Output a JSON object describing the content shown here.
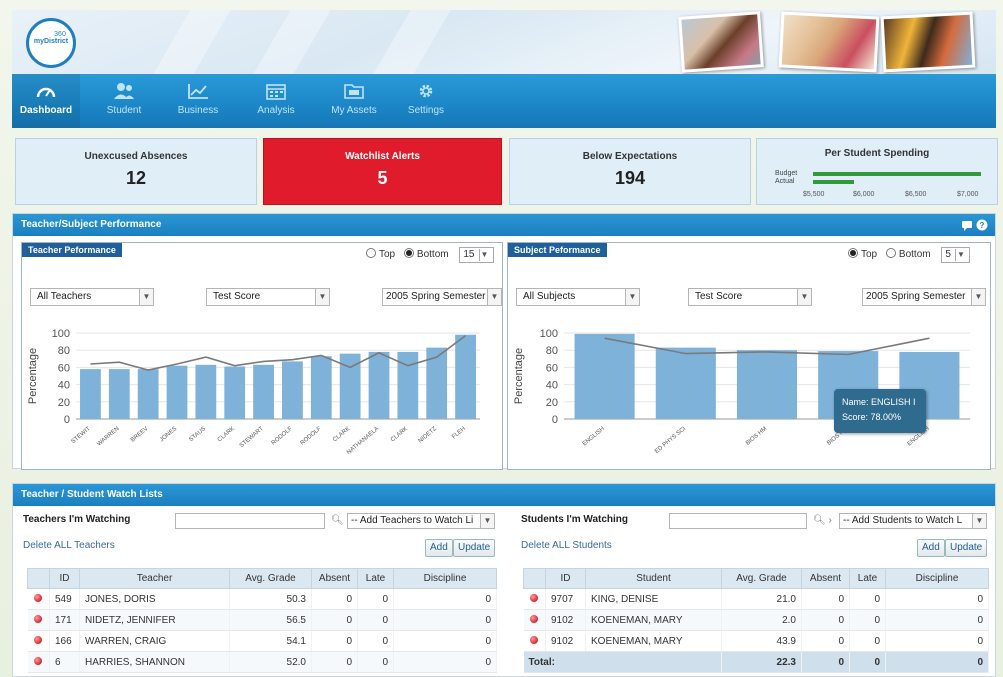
{
  "logo": {
    "line1": "360",
    "line2": "myDistrict"
  },
  "nav": [
    {
      "label": "Dashboard",
      "icon": "gauge-icon",
      "active": true
    },
    {
      "label": "Student",
      "icon": "users-icon"
    },
    {
      "label": "Business",
      "icon": "line-chart-icon"
    },
    {
      "label": "Analysis",
      "icon": "calendar-icon"
    },
    {
      "label": "My Assets",
      "icon": "folder-icon"
    },
    {
      "label": "Settings",
      "icon": "gear-icon"
    }
  ],
  "kpis": {
    "absences": {
      "title": "Unexcused Absences",
      "value": "12"
    },
    "watchlist": {
      "title": "Watchlist Alerts",
      "value": "5"
    },
    "below": {
      "title": "Below Expectations",
      "value": "194"
    },
    "spending": {
      "title": "Per Student Spending",
      "budget_label": "Budget",
      "actual_label": "Actual",
      "ticks": [
        "$5,500",
        "$6,000",
        "$6,500",
        "$7,000"
      ],
      "budget_value": 6970,
      "actual_value": 5780,
      "axis_min": 5400,
      "axis_max": 7100
    }
  },
  "performance": {
    "title": "Teacher/Subject Performance",
    "teacher": {
      "title": "Teacher Peformance",
      "radio_top": "Top",
      "radio_bottom": "Bottom",
      "count": "15",
      "filter_who": "All Teachers",
      "filter_metric": "Test Score",
      "filter_term": "2005 Spring Semester"
    },
    "subject": {
      "title": "Subject Peformance",
      "radio_top": "Top",
      "radio_bottom": "Bottom",
      "count": "5",
      "filter_who": "All Subjects",
      "filter_metric": "Test Score",
      "filter_term": "2005 Spring Semester",
      "tooltip_name": "Name:  ENGLISH I",
      "tooltip_score": "Score:  78.00%"
    }
  },
  "chart_data": [
    {
      "type": "bar",
      "ylabel": "Percentage",
      "ylim": [
        0,
        100
      ],
      "yticks": [
        0,
        20,
        40,
        60,
        80,
        100
      ],
      "categories": [
        "STEWIT",
        "WARREN",
        "BREEV",
        "JONES",
        "STAUS",
        "CLARK",
        "STEWART",
        "RODOLF",
        "RODOLF",
        "CLARK",
        "NATHANAELA",
        "CLARK",
        "NIDETZ",
        "FLEH"
      ],
      "series": [
        {
          "values": [
            58,
            58,
            58,
            62,
            63,
            61,
            63,
            67,
            73,
            76,
            78,
            78,
            83,
            98
          ]
        },
        {
          "type": "line",
          "values": [
            64,
            66,
            57,
            64,
            72,
            62,
            67,
            69,
            74,
            60,
            77,
            62,
            72,
            97
          ]
        }
      ]
    },
    {
      "type": "bar",
      "ylabel": "Percentage",
      "ylim": [
        0,
        100
      ],
      "yticks": [
        0,
        20,
        40,
        60,
        80,
        100
      ],
      "categories": [
        "ENGLISH",
        "ED PHYS SCI",
        "BIOS HM",
        "BIOS HM",
        "ENGLISH"
      ],
      "series": [
        {
          "values": [
            99,
            83,
            80,
            79,
            78
          ]
        },
        {
          "type": "line",
          "values": [
            94,
            76,
            78,
            75,
            94
          ]
        }
      ]
    }
  ],
  "watch": {
    "title": "Teacher / Student Watch Lists",
    "teachers": {
      "heading": "Teachers I'm Watching",
      "add_select": "-- Add Teachers to Watch Li",
      "delete_all": "Delete ALL Teachers",
      "add": "Add",
      "update": "Update",
      "columns": [
        "ID",
        "Teacher",
        "Avg. Grade",
        "Absent",
        "Late",
        "Discipline"
      ],
      "rows": [
        {
          "id": "549",
          "name": "JONES, DORIS",
          "grade": "50.3",
          "absent": "0",
          "late": "0",
          "discipline": "0"
        },
        {
          "id": "171",
          "name": "NIDETZ, JENNIFER",
          "grade": "56.5",
          "absent": "0",
          "late": "0",
          "discipline": "0"
        },
        {
          "id": "166",
          "name": "WARREN, CRAIG",
          "grade": "54.1",
          "absent": "0",
          "late": "0",
          "discipline": "0"
        },
        {
          "id": "6",
          "name": "HARRIES, SHANNON",
          "grade": "52.0",
          "absent": "0",
          "late": "0",
          "discipline": "0"
        }
      ]
    },
    "students": {
      "heading": "Students I'm Watching",
      "add_select": "-- Add Students to Watch L",
      "delete_all": "Delete ALL Students",
      "add": "Add",
      "update": "Update",
      "columns": [
        "ID",
        "Student",
        "Avg. Grade",
        "Absent",
        "Late",
        "Discipline"
      ],
      "rows": [
        {
          "id": "9707",
          "name": "KING, DENISE",
          "grade": "21.0",
          "absent": "0",
          "late": "0",
          "discipline": "0"
        },
        {
          "id": "9102",
          "name": "KOENEMAN, MARY",
          "grade": "2.0",
          "absent": "0",
          "late": "0",
          "discipline": "0"
        },
        {
          "id": "9102",
          "name": "KOENEMAN, MARY",
          "grade": "43.9",
          "absent": "0",
          "late": "0",
          "discipline": "0"
        }
      ],
      "total_label": "Total:",
      "total": {
        "grade": "22.3",
        "absent": "0",
        "late": "0",
        "discipline": "0"
      }
    }
  },
  "colors": {
    "accent": "#1b86c7",
    "alert": "#e01b2b",
    "bar": "#7fb2d9",
    "line": "#7a7a7a",
    "spend": "#2e9a3a"
  }
}
